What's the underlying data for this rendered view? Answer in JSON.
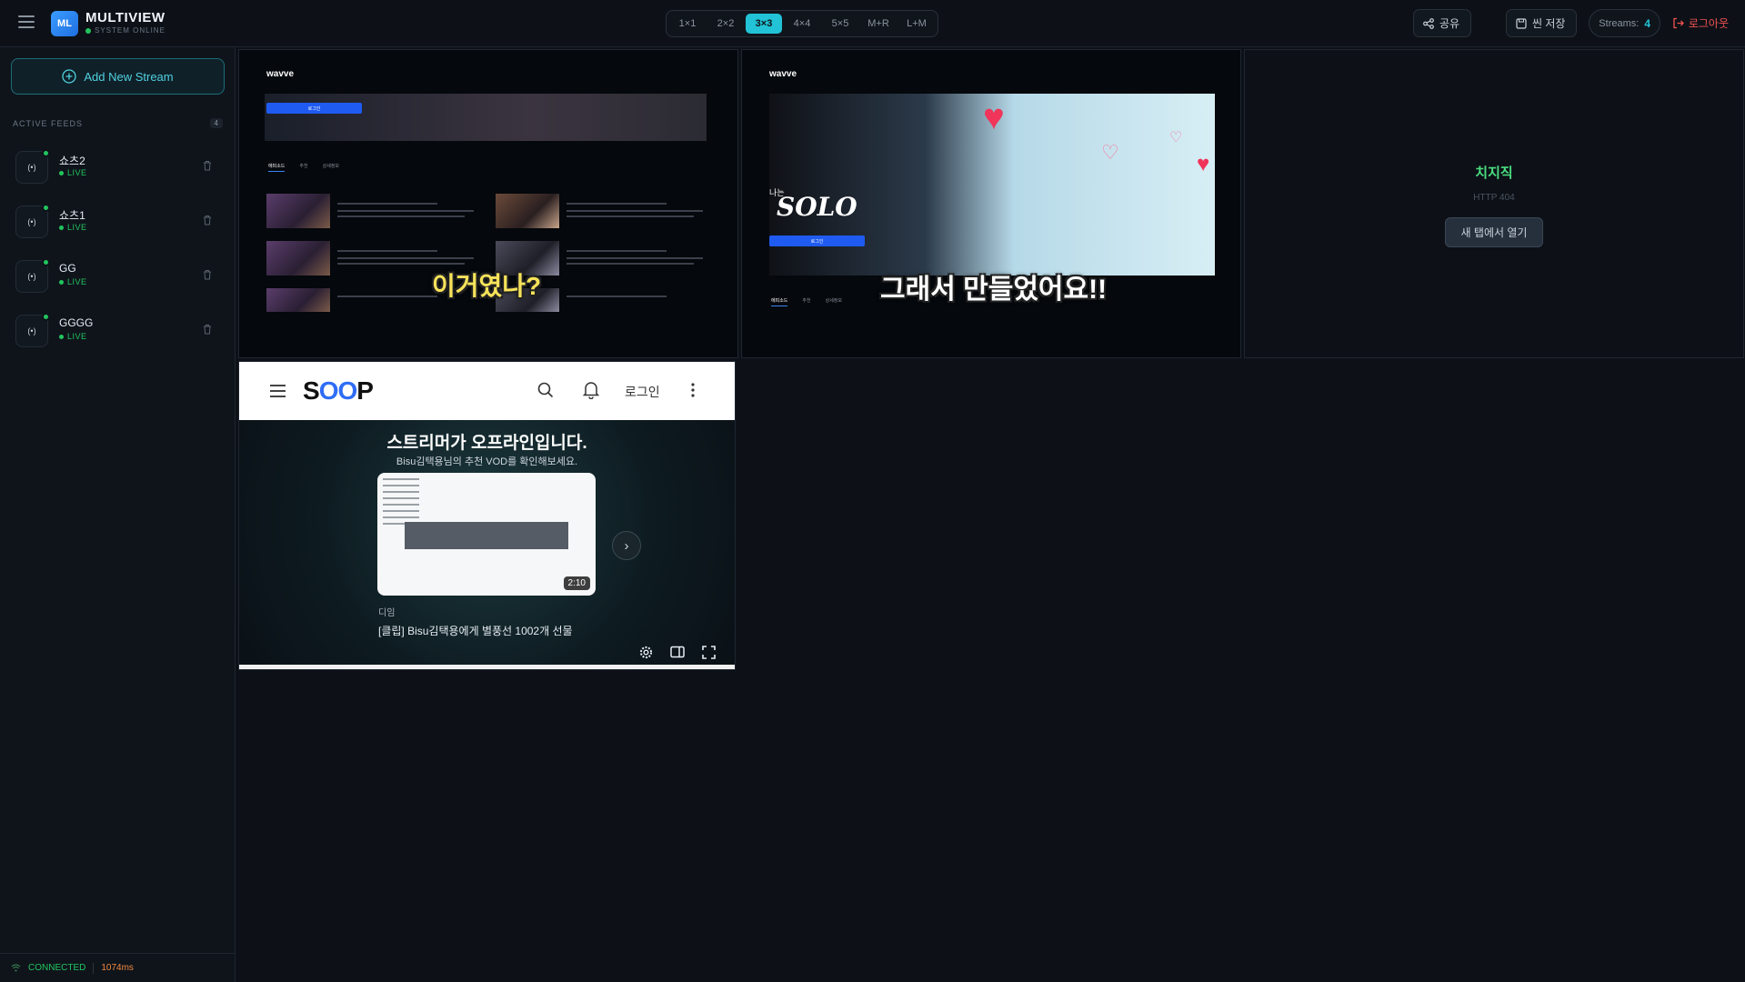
{
  "header": {
    "logo_badge": "ML",
    "title": "MULTIVIEW",
    "status": "SYSTEM ONLINE",
    "layouts": [
      "1×1",
      "2×2",
      "3×3",
      "4×4",
      "5×5",
      "M+R",
      "L+M"
    ],
    "active_layout": "3×3",
    "share_label": "공유",
    "save_label": "씬 저장",
    "streams_label": "Streams:",
    "streams_count": "4",
    "logout_label": "로그아웃"
  },
  "sidebar": {
    "add_stream_label": "Add New Stream",
    "feeds_title": "ACTIVE FEEDS",
    "feeds_count": "4",
    "feed_icon_text": "(•)",
    "feeds": [
      {
        "name": "쇼츠2",
        "status": "LIVE"
      },
      {
        "name": "쇼츠1",
        "status": "LIVE"
      },
      {
        "name": "GG",
        "status": "LIVE"
      },
      {
        "name": "GGGG",
        "status": "LIVE"
      }
    ],
    "connection": "CONNECTED",
    "latency": "1074ms"
  },
  "tiles": {
    "wavve_logo": "wavve",
    "wavve_tab_episodes": "에피소드",
    "wavve_tab_rec": "추천",
    "wavve_tab_detail": "상세정보",
    "wavve_login_btn": "로그인",
    "tile1_caption": "이거였나?",
    "tile2_caption": "그래서 만들었어요!!",
    "tile2_show_title": "SOLO",
    "tile2_show_pre": "나는",
    "tile3_name": "치지직",
    "tile3_error": "HTTP 404",
    "tile3_open": "새 탭에서 열기",
    "soop_login": "로그인",
    "soop_heading": "스트리머가 오프라인입니다.",
    "soop_sub": "Bisu김택용님의 추천 VOD를 확인해보세요.",
    "vod_duration": "2:10",
    "vod_channel": "디임",
    "vod_title": "[클립] Bisu김택용에게 별풍선 1002개 선물"
  },
  "colors": {
    "accent": "#22c3d6",
    "live": "#22c55e",
    "logout": "#f05252",
    "latency": "#f0883e"
  }
}
